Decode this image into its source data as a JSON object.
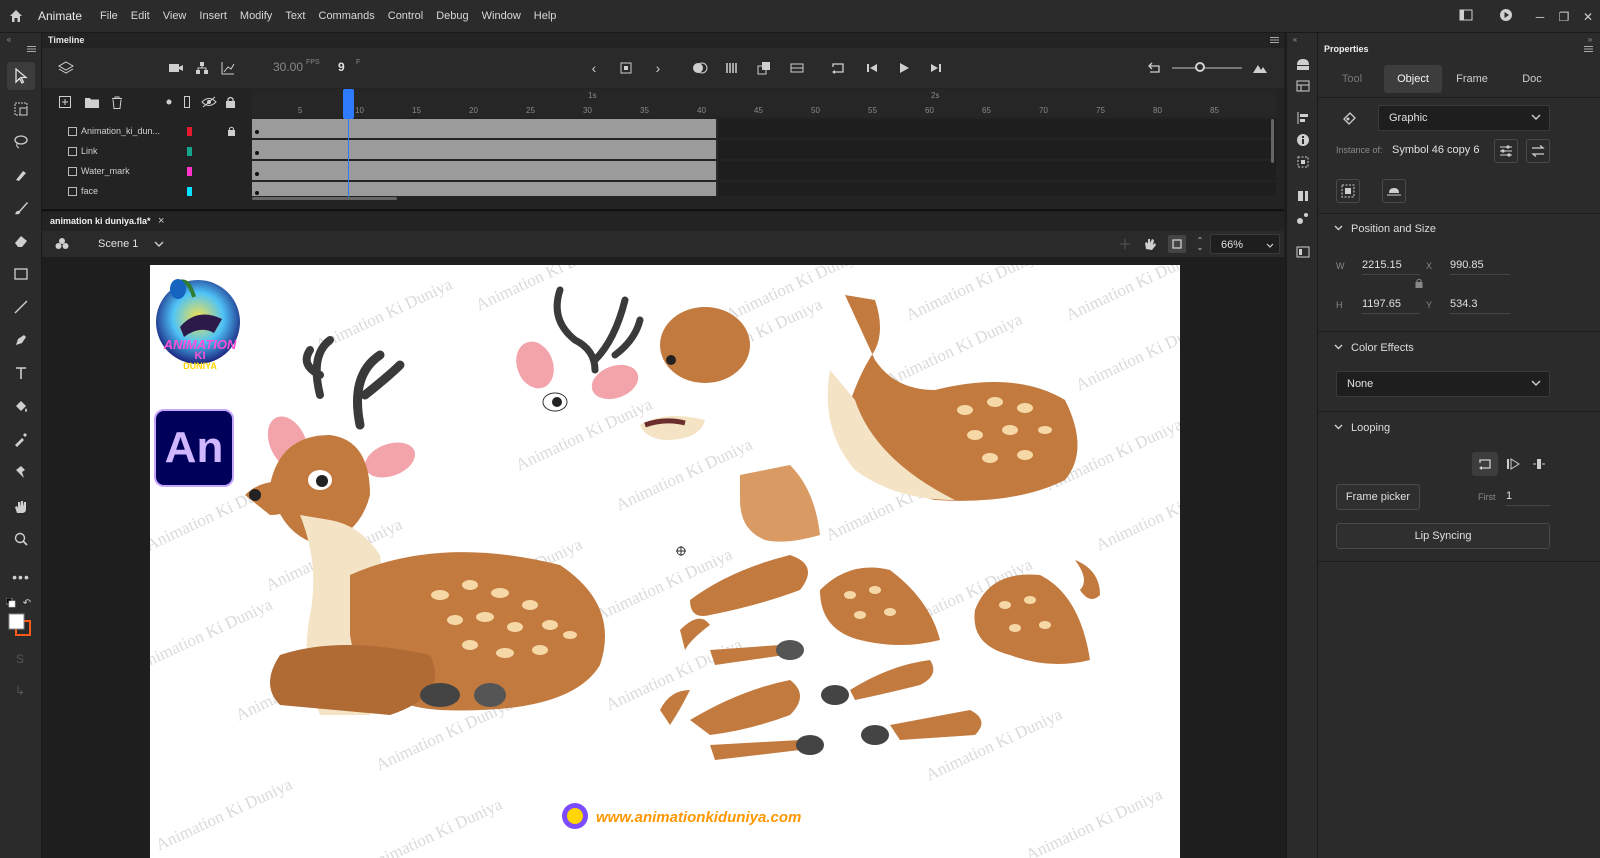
{
  "app": {
    "name": "Animate"
  },
  "menu": [
    "File",
    "Edit",
    "View",
    "Insert",
    "Modify",
    "Text",
    "Commands",
    "Control",
    "Debug",
    "Window",
    "Help"
  ],
  "timeline": {
    "tab_label": "Timeline",
    "fps_value": "30.00",
    "fps_unit": "FPS",
    "current_frame": "9",
    "frame_unit": "F",
    "ruler_numbers": [
      "5",
      "10",
      "15",
      "20",
      "25",
      "30",
      "35",
      "40",
      "45",
      "50",
      "55",
      "60",
      "65",
      "70",
      "75",
      "80",
      "85"
    ],
    "seconds_markers": [
      "1s",
      "2s"
    ],
    "layers": [
      {
        "name": "Animation_ki_dun...",
        "color": "#e8192c",
        "locked": true
      },
      {
        "name": "Link",
        "color": "#14a38b",
        "locked": false
      },
      {
        "name": "Water_mark",
        "color": "#ff33cc",
        "locked": false
      },
      {
        "name": "face",
        "color": "#00e5ff",
        "locked": false
      }
    ]
  },
  "document": {
    "tab_title": "animation ki duniya.fla*",
    "close": "×",
    "scene": "Scene 1",
    "zoom": "66%"
  },
  "stage": {
    "logo_text_top": "ANIMATION",
    "logo_text_mid": "KI",
    "logo_text_bot": "DUNIYA",
    "an_logo": "An",
    "watermark": "Animation Ki Duniya",
    "website": "www.animationkiduniya.com"
  },
  "properties": {
    "title": "Properties",
    "tabs": [
      "Tool",
      "Object",
      "Frame",
      "Doc"
    ],
    "active_tab": "Object",
    "symbol_type": "Graphic",
    "instance_of_label": "Instance of:",
    "instance_of_value": "Symbol 46 copy 6",
    "position_size": {
      "title": "Position and Size",
      "w_label": "W",
      "w": "2215.15",
      "h_label": "H",
      "h": "1197.65",
      "x_label": "X",
      "x": "990.85",
      "y_label": "Y",
      "y": "534.3"
    },
    "color_effects": {
      "title": "Color Effects",
      "value": "None"
    },
    "looping": {
      "title": "Looping",
      "frame_picker": "Frame picker",
      "first_label": "First",
      "first_value": "1",
      "lip_syncing": "Lip Syncing"
    }
  }
}
